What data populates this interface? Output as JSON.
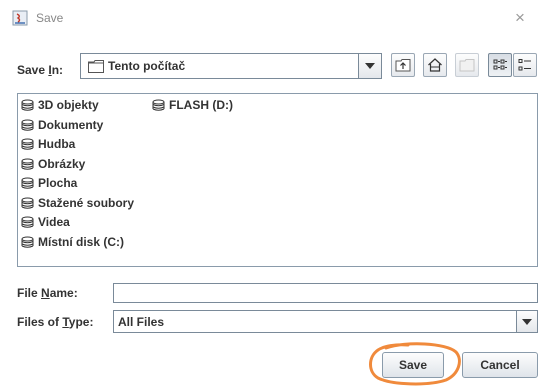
{
  "window": {
    "title": "Save",
    "close_glyph": "×"
  },
  "save_in": {
    "label_prefix": "Save ",
    "label_mnemonic": "I",
    "label_suffix": "n:",
    "current_folder": "Tento počítač",
    "toolbar_icons": [
      "up-one-level-icon",
      "home-icon",
      "new-folder-icon",
      "list-view-icon",
      "details-view-icon"
    ]
  },
  "files": {
    "column1": [
      "3D objekty",
      "Dokumenty",
      "Hudba",
      "Obrázky",
      "Plocha",
      "Stažené soubory",
      "Videa",
      "Místní disk (C:)"
    ],
    "column2": [
      "FLASH (D:)"
    ]
  },
  "file_name": {
    "label_prefix": "File ",
    "label_mnemonic": "N",
    "label_suffix": "ame:",
    "value": ""
  },
  "file_type": {
    "label_prefix": "Files of ",
    "label_mnemonic": "T",
    "label_suffix": "ype:",
    "selected": "All Files"
  },
  "buttons": {
    "save": "Save",
    "cancel": "Cancel"
  },
  "colors": {
    "highlight_circle": "#f08a3c",
    "border": "#7a8a99"
  }
}
